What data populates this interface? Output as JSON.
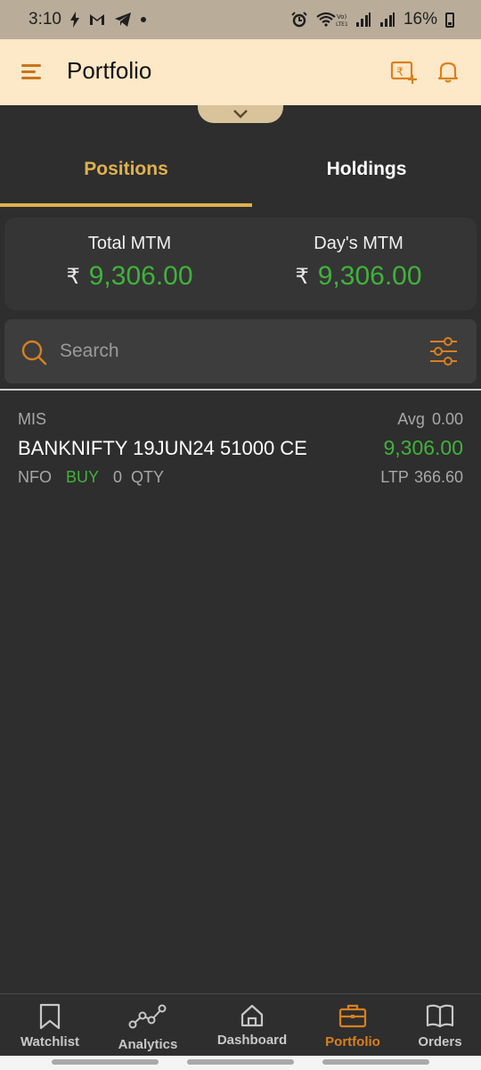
{
  "status_bar": {
    "time": "3:10",
    "battery": "16%"
  },
  "header": {
    "title": "Portfolio"
  },
  "tabs": [
    {
      "label": "Positions",
      "active": true
    },
    {
      "label": "Holdings",
      "active": false
    }
  ],
  "mtm": {
    "currency_symbol": "₹",
    "total": {
      "label": "Total MTM",
      "value": "9,306.00"
    },
    "day": {
      "label": "Day's MTM",
      "value": "9,306.00"
    }
  },
  "search": {
    "placeholder": "Search"
  },
  "positions": [
    {
      "product": "MIS",
      "avg_label": "Avg",
      "avg_value": "0.00",
      "symbol": "BANKNIFTY 19JUN24 51000 CE",
      "pnl": "9,306.00",
      "exchange": "NFO",
      "side": "BUY",
      "qty": "0",
      "qty_label": "QTY",
      "ltp_label": "LTP",
      "ltp_value": "366.60"
    }
  ],
  "bottom_nav": [
    {
      "label": "Watchlist",
      "icon": "bookmark-icon"
    },
    {
      "label": "Analytics",
      "icon": "analytics-icon"
    },
    {
      "label": "Dashboard",
      "icon": "home-icon"
    },
    {
      "label": "Portfolio",
      "icon": "briefcase-icon",
      "active": true
    },
    {
      "label": "Orders",
      "icon": "book-icon"
    }
  ],
  "colors": {
    "accent": "#e0b14e",
    "orange": "#d9801f",
    "profit": "#3fb33a",
    "background": "#2e2e2e",
    "header_bg": "#fde8c7"
  }
}
